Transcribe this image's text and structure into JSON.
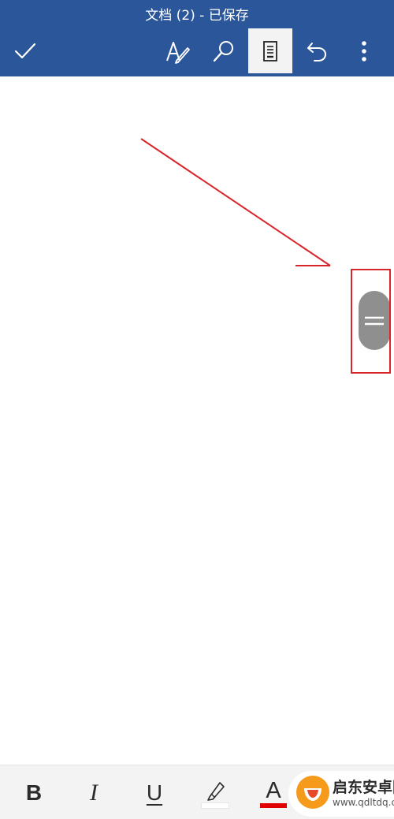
{
  "header": {
    "title": "文档 (2) - 已保存",
    "icons": [
      "checkmark-icon",
      "draw-pen-icon",
      "search-icon",
      "reading-view-icon",
      "undo-icon",
      "more-vertical-icon"
    ],
    "active_button": "reading-view",
    "background": "#2b579a"
  },
  "document": {
    "background": "#ffffff"
  },
  "annotation": {
    "color": "#d9262b",
    "target": "scroll-thumb"
  },
  "scrollbar": {
    "thumb_color": "#8f8f8f",
    "icon": "grip-lines-icon"
  },
  "format_bar": {
    "bold_label": "B",
    "italic_label": "I",
    "underline_label": "U",
    "highlight_icon": "highlighter-icon",
    "highlight_color": "#ffffff",
    "font_color_label": "A",
    "font_color": "#e00000"
  },
  "watermark": {
    "line1": "启东安卓网",
    "line2": "www.qdltdq.com"
  }
}
